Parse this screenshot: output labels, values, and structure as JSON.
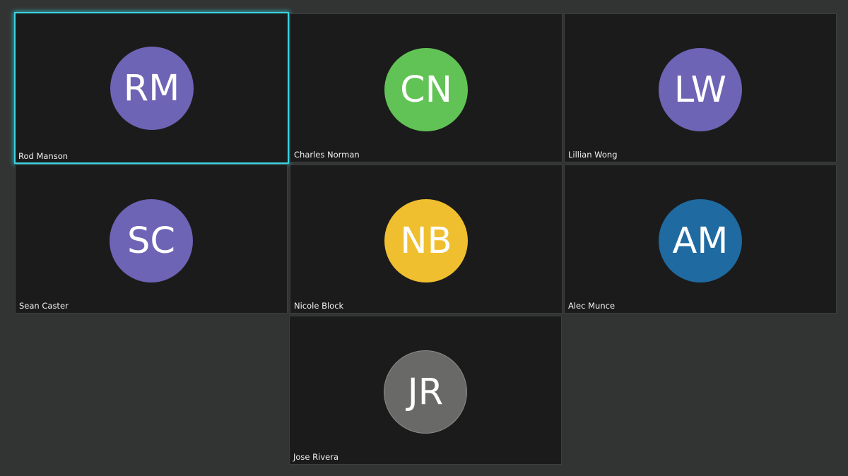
{
  "participants": [
    {
      "name": "Rod Manson",
      "initials": "RM",
      "color": "#6d64b6",
      "active": true
    },
    {
      "name": "Charles Norman",
      "initials": "CN",
      "color": "#61c355",
      "active": false
    },
    {
      "name": "Lillian Wong",
      "initials": "LW",
      "color": "#6d64b6",
      "active": false
    },
    {
      "name": "Sean Caster",
      "initials": "SC",
      "color": "#6d64b6",
      "active": false
    },
    {
      "name": "Nicole Block",
      "initials": "NB",
      "color": "#f0bf2f",
      "active": false
    },
    {
      "name": "Alec Munce",
      "initials": "AM",
      "color": "#1f6aa1",
      "active": false
    },
    {
      "name": "Jose Rivera",
      "initials": "JR",
      "color": "#696968",
      "active": false
    }
  ]
}
